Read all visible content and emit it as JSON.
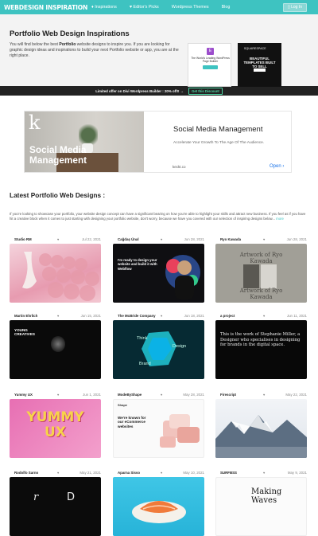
{
  "header": {
    "logo": "WEBDESIGN INSPIRATION",
    "nav": [
      "♦ Inspirations",
      "♥ Editor's Picks",
      "Wordpress Themes",
      "Blog"
    ],
    "login": "▯ Log In"
  },
  "hero": {
    "title": "Portfolio Web Design Inspirations",
    "desc_1": "You will find below the best ",
    "desc_bold": "Portfolio",
    "desc_2": " website designs to inspire you. If you are looking for graphic design ideas and inspirations to build your next Portfolio website or app, you are at the right place.",
    "ad1_text": "The World's Leading WordPress Page Builder",
    "ad2_brand": "SQUARESPACE",
    "ad2_text": "BEAUTIFUL TEMPLATES BUILT TO SELL"
  },
  "promo": {
    "text": "Limited offer on Divi Wordpress Builder : 20% off!! →",
    "cta": "Get this Discount"
  },
  "big_ad": {
    "image_headline": "Social Media Management",
    "title": "Social Media Management",
    "subtitle": "Accelerate Your Growth To The Age Of The Audience.",
    "domain": "keckt.co",
    "open": "Open ›"
  },
  "section": {
    "title": "Latest Portfolio Web Designs :",
    "intro": "If you're looking to showcase your portfolio, your website design concept can have a significant bearing on how you're able to highlight your skills and attract new business. If you feel as if you have hit a creative block when it comes to just starting with designing your portfolio website, don't worry, because we have you covered with our selection of inspiring designs below...",
    "more": "more"
  },
  "cards": [
    {
      "name": "Studio RM",
      "date": "Jul 22, 2021"
    },
    {
      "name": "Cağdaş Ünal",
      "date": "Jun 28, 2021"
    },
    {
      "name": "Ryo Kawada",
      "date": "Jun 28, 2021"
    },
    {
      "name": "Martin Ehrlich",
      "date": "Jun 15, 2021"
    },
    {
      "name": "The McBride Company",
      "date": "Jun 18, 2021"
    },
    {
      "name": "a project",
      "date": "Jun 11, 2021"
    },
    {
      "name": "Yummy UX",
      "date": "Jun 1, 2021"
    },
    {
      "name": "ModeByShape",
      "date": "May 28, 2021"
    },
    {
      "name": "Firescript",
      "date": "May 22, 2021"
    },
    {
      "name": "Rodolfo Sarno",
      "date": "May 21, 2021"
    },
    {
      "name": "Aparna Sisso",
      "date": "May 10, 2021"
    },
    {
      "name": "SURFBSS",
      "date": "May 9, 2021"
    }
  ],
  "card_thumbs": {
    "cagdas_heading": "I'm ready to design your website and build it with Webflow",
    "ryo_text": "Artwork of Ryo Kawada",
    "martin_text": "YOUNG CREATIVES",
    "mcbride_words": [
      "Think",
      "Design",
      "Brand"
    ],
    "aproject_text": "This is the work of Stephanie Miller, a Designer who specialises in designing for brands in the digital space.",
    "yummy_text": "YUMMY UX",
    "mode_brand": "Shape",
    "mode_text": "We're known for our eCommerce websites",
    "rodolfo_letters": [
      "r",
      "D"
    ],
    "surf_text": "Making Waves"
  },
  "colors": {
    "brand": "#3ec3c1",
    "dark": "#222222",
    "promo_accent": "#4fd7a5"
  }
}
